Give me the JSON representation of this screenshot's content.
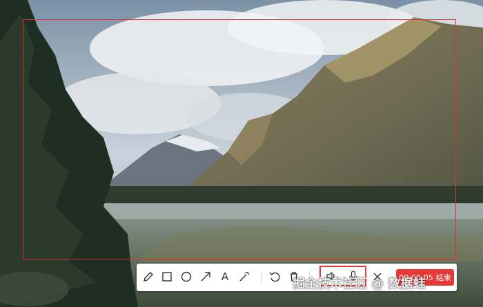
{
  "background": {
    "description_icon": "landscape-photo",
    "colors": {
      "sky": "#9fb0c0",
      "water": "#6f7f76",
      "frame": "#e03030"
    }
  },
  "toolbar": {
    "tools": [
      {
        "name": "pencil-icon",
        "label": ""
      },
      {
        "name": "rectangle-icon",
        "label": ""
      },
      {
        "name": "circle-icon",
        "label": ""
      },
      {
        "name": "arrow-icon",
        "label": ""
      },
      {
        "name": "text-icon",
        "label": "A"
      },
      {
        "name": "magic-wand-icon",
        "label": ""
      },
      {
        "name": "undo-icon",
        "label": ""
      },
      {
        "name": "trash-icon",
        "label": ""
      },
      {
        "name": "speaker-icon",
        "label": ""
      },
      {
        "name": "microphone-icon",
        "label": ""
      },
      {
        "name": "close-icon",
        "label": ""
      }
    ],
    "timer": "00:00:05",
    "end_label": "结束",
    "accent": "#e53935"
  },
  "watermark": "掘金技术社区 @ 数据蛙"
}
